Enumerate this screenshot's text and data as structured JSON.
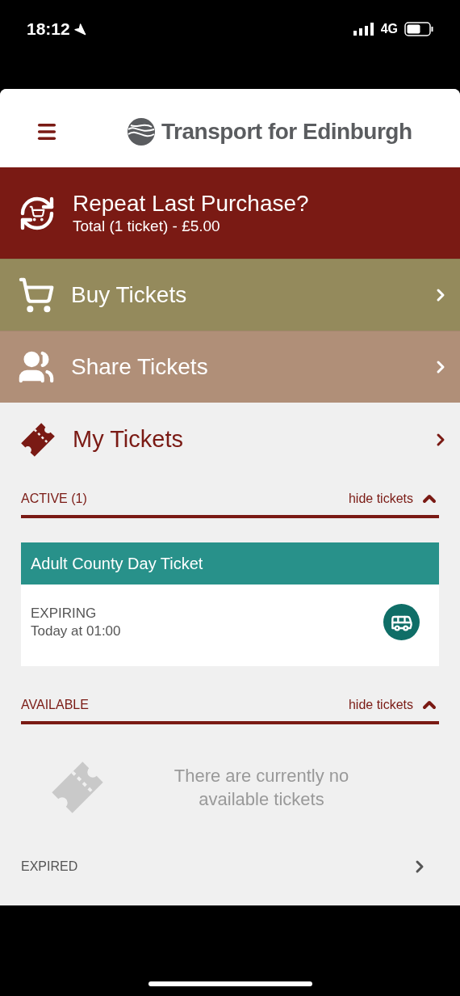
{
  "status_bar": {
    "time": "18:12",
    "network": "4G"
  },
  "header": {
    "title": "Transport for Edinburgh"
  },
  "menu": [
    {
      "kind": "repeat",
      "label": "Repeat Last Purchase?",
      "detail": "Total (1 ticket) - £5.00",
      "color": "#7a1a14"
    },
    {
      "kind": "buy",
      "label": "Buy Tickets",
      "color": "#948a5c"
    },
    {
      "kind": "share",
      "label": "Share Tickets",
      "color": "#b08f78"
    }
  ],
  "my_tickets": {
    "title": "My Tickets"
  },
  "sections": [
    {
      "kind": "list",
      "label": "ACTIVE (1)",
      "toggle": "hide tickets",
      "expanded": true,
      "tickets": [
        {
          "name": "Adult County Day Ticket",
          "status": "EXPIRING",
          "time": "Today at 01:00"
        }
      ]
    },
    {
      "kind": "empty",
      "label": "AVAILABLE",
      "toggle": "hide tickets",
      "expanded": true,
      "message": "There are currently no available tickets"
    },
    {
      "kind": "link",
      "label": "EXPIRED"
    }
  ]
}
